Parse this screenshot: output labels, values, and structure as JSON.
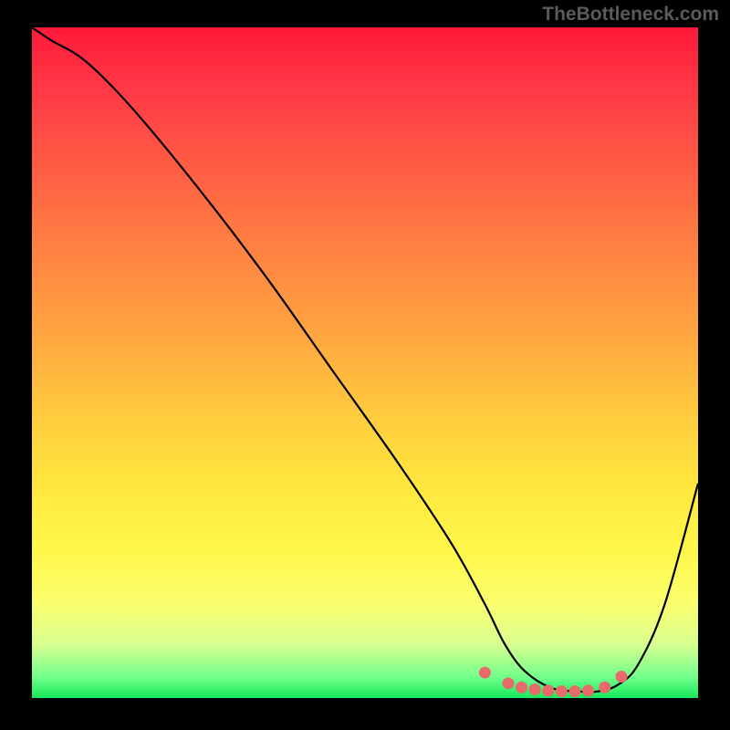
{
  "watermark": "TheBottleneck.com",
  "chart_data": {
    "type": "line",
    "title": "",
    "xlabel": "",
    "ylabel": "",
    "xlim": [
      0,
      100
    ],
    "ylim": [
      0,
      100
    ],
    "series": [
      {
        "name": "curve",
        "x": [
          0,
          3,
          8,
          15,
          25,
          35,
          45,
          55,
          63,
          68,
          71,
          74,
          78,
          82,
          85,
          88,
          91,
          95,
          100
        ],
        "values": [
          100,
          98,
          95,
          88,
          76,
          63,
          49,
          35,
          23,
          14,
          8,
          4,
          1.5,
          1,
          1,
          2,
          5,
          14,
          32
        ],
        "color": "#000000"
      },
      {
        "name": "markers",
        "x": [
          68,
          71.5,
          73.5,
          75.5,
          77.5,
          79.5,
          81.5,
          83.5,
          86,
          88.5
        ],
        "values": [
          3.8,
          2.2,
          1.6,
          1.3,
          1.1,
          1.0,
          1.0,
          1.1,
          1.6,
          3.2
        ],
        "color": "#e86a6a"
      }
    ]
  },
  "colors": {
    "background": "#000000",
    "curve": "#000000",
    "markers": "#e86a6a",
    "watermark": "#5a5a5a"
  }
}
